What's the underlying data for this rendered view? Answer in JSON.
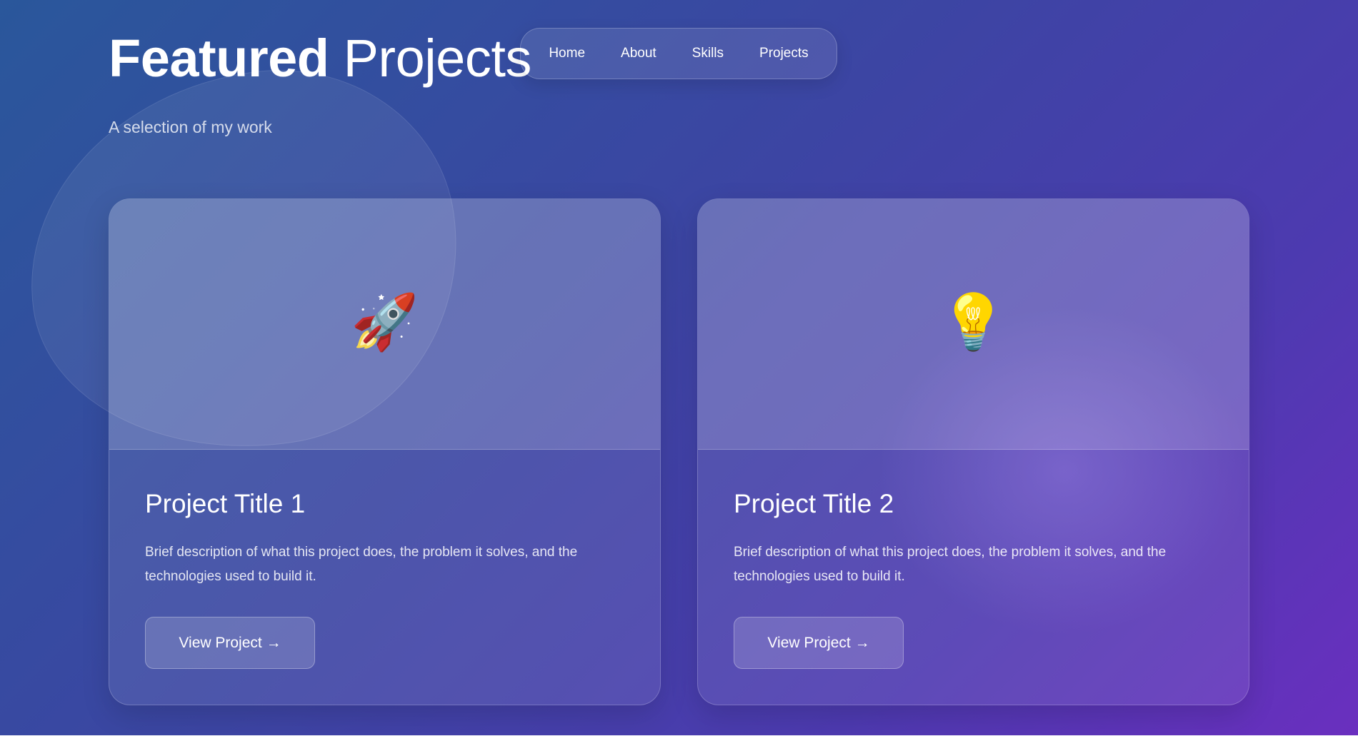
{
  "header": {
    "title_bold": "Featured",
    "title_light": "Projects",
    "subtitle": "A selection of my work"
  },
  "nav": {
    "items": [
      {
        "label": "Home"
      },
      {
        "label": "About"
      },
      {
        "label": "Skills"
      },
      {
        "label": "Projects"
      }
    ]
  },
  "projects": [
    {
      "icon": "🚀",
      "icon_name": "rocket-icon",
      "title": "Project Title 1",
      "description": "Brief description of what this project does, the problem it solves, and the technologies used to build it.",
      "button_label": "View Project →"
    },
    {
      "icon": "💡",
      "icon_name": "lightbulb-icon",
      "title": "Project Title 2",
      "description": "Brief description of what this project does, the problem it solves, and the technologies used to build it.",
      "button_label": "View Project →"
    }
  ],
  "colors": {
    "background_start": "#2a579b",
    "background_end": "#6a2fbf",
    "text": "#ffffff"
  }
}
